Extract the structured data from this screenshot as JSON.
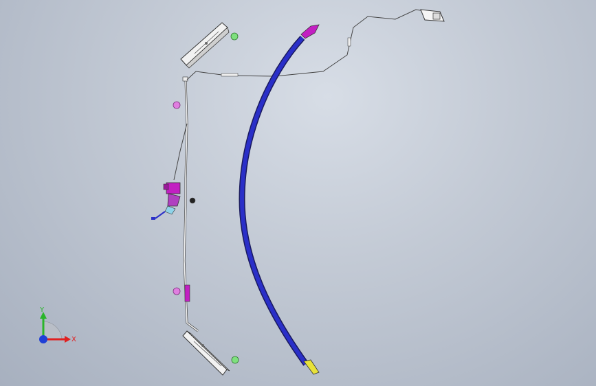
{
  "viewport": {
    "background_top": "#d7dde6",
    "background_bottom": "#a7b0bf"
  },
  "triad": {
    "x_label": "X",
    "y_label": "Y",
    "x_color": "#e02020",
    "y_color": "#2ab52a",
    "z_color": "#1f3fd6"
  },
  "model": {
    "hose_color": "#2a2fc8",
    "accent_magenta": "#c21fc2",
    "accent_yellow": "#e8e23a",
    "cap_green": "#7ee07e"
  }
}
